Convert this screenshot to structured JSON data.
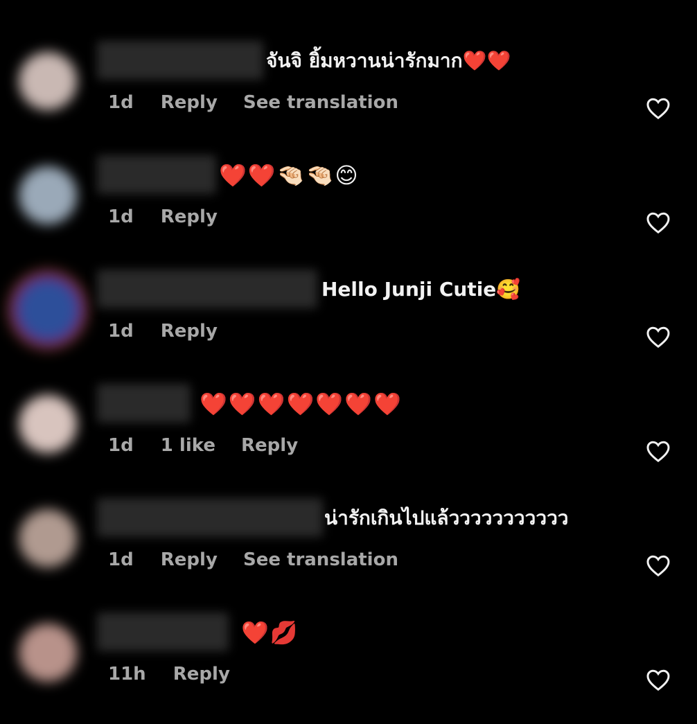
{
  "comments": [
    {
      "text": "จันจิ ยิ้มหวานน่ารักมาก❤️❤️",
      "time": "1d",
      "likes": "",
      "reply_label": "Reply",
      "translate_label": "See translation",
      "avatar_color": "#c9b8b3"
    },
    {
      "text": "❤️❤️🤏🏻🤏🏻😊",
      "time": "1d",
      "likes": "",
      "reply_label": "Reply",
      "translate_label": "",
      "avatar_color": "#9aa9b8"
    },
    {
      "text": "Hello Junji Cutie🥰",
      "time": "1d",
      "likes": "",
      "reply_label": "Reply",
      "translate_label": "",
      "avatar_color": "#2d4f9a"
    },
    {
      "text": "❤️❤️❤️❤️❤️❤️❤️",
      "time": "1d",
      "likes": "1 like",
      "reply_label": "Reply",
      "translate_label": "",
      "avatar_color": "#d8c4be"
    },
    {
      "text": "น่ารักเกินไปแล้ววววววววววว",
      "time": "1d",
      "likes": "",
      "reply_label": "Reply",
      "translate_label": "See translation",
      "avatar_color": "#b09a90"
    },
    {
      "text": "❤️💋",
      "time": "11h",
      "likes": "",
      "reply_label": "Reply",
      "translate_label": "",
      "avatar_color": "#b8928a"
    }
  ],
  "icons": {
    "like": "heart-outline-icon"
  },
  "colors": {
    "background": "#000000",
    "text": "#f2f2f2",
    "meta": "#a8a8a8"
  }
}
